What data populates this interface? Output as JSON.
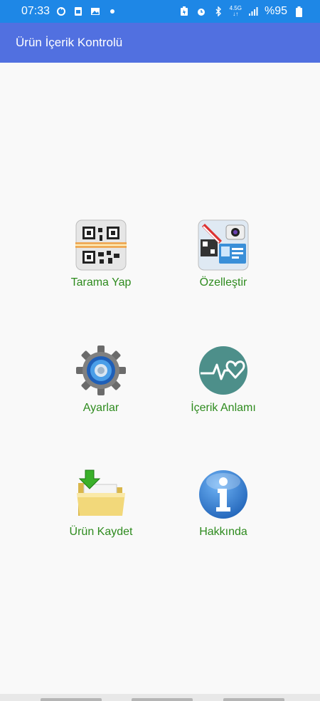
{
  "status_bar": {
    "time": "07:33",
    "network": "4.5G",
    "battery": "%95",
    "left_icons": [
      "sync-icon",
      "sim-icon",
      "gallery-icon",
      "notification-dot-icon"
    ],
    "right_icons": [
      "battery-saver-icon",
      "alarm-icon",
      "bluetooth-icon",
      "network-icon",
      "signal-icon",
      "battery-icon"
    ]
  },
  "app_bar": {
    "title": "Ürün İçerik Kontrolü",
    "color": "#5170e0"
  },
  "menu": {
    "label_color": "#2e8b1e",
    "items": [
      {
        "label": "Tarama Yap",
        "icon": "qr-scan-icon"
      },
      {
        "label": "Özelleştir",
        "icon": "customize-icon"
      },
      {
        "label": "Ayarlar",
        "icon": "gear-icon"
      },
      {
        "label": "İçerik Anlamı",
        "icon": "heartbeat-icon"
      },
      {
        "label": "Ürün Kaydet",
        "icon": "folder-download-icon"
      },
      {
        "label": "Hakkında",
        "icon": "info-icon"
      }
    ]
  }
}
